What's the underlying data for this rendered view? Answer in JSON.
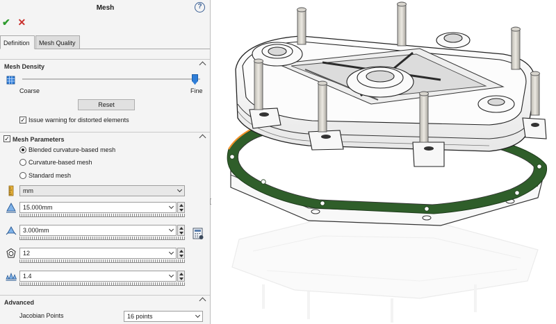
{
  "panel": {
    "title": "Mesh",
    "help_glyph": "?",
    "ok_glyph": "✔",
    "cancel_glyph": "✕",
    "tabs": [
      "Definition",
      "Mesh Quality"
    ],
    "mesh_density": {
      "header": "Mesh Density",
      "coarse_label": "Coarse",
      "fine_label": "Fine",
      "slider_level": 1.0,
      "reset_label": "Reset",
      "warning_label": "Issue warning for distorted elements",
      "warning_checked": true
    },
    "mesh_parameters": {
      "header": "Mesh Parameters",
      "checked": true,
      "options": [
        "Blended curvature-based mesh",
        "Curvature-based mesh",
        "Standard mesh"
      ],
      "selected_index": 0,
      "unit": "mm",
      "max_element_size": "15.000mm",
      "min_element_size": "3.000mm",
      "min_elements_in_circle": "12",
      "growth_ratio": "1.4"
    },
    "advanced": {
      "header": "Advanced",
      "jacobian_label": "Jacobian Points",
      "jacobian_value": "16 points"
    }
  },
  "colors": {
    "accent": "#2f7ed8",
    "ok": "#2d9b2d",
    "cancel": "#c9302c",
    "gasket": "#2f5e2a",
    "highlight_edge": "#f0922b"
  }
}
